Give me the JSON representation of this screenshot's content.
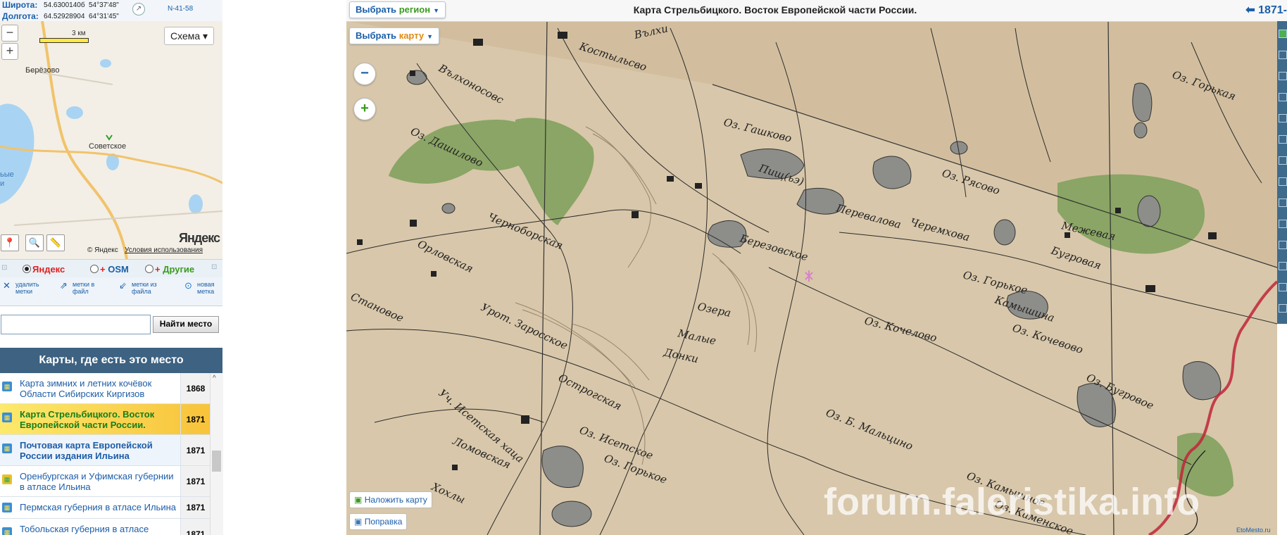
{
  "coords": {
    "lat_label": "Широта:",
    "lat_decimal": "54.6300140б",
    "lat_dms": "54°37'48\"",
    "lon_label": "Долгота:",
    "lon_decimal": "64.52928904",
    "lon_dms": "64°31'45\"",
    "sheet": "N-41-58"
  },
  "minimap": {
    "zoom_out": "−",
    "zoom_in": "+",
    "scale": "3 км",
    "type_select": "Схема",
    "towns": [
      "Берёзово",
      "Советское",
      "ьые",
      "и"
    ],
    "logo": "Яндекс",
    "copyright": "© Яндекс",
    "terms": "Условия использования"
  },
  "sources": {
    "yandex": "Яндекс",
    "osm": "OSM",
    "others": "Другие",
    "selected": "yandex"
  },
  "marks": {
    "delete": [
      "удалить",
      "метки"
    ],
    "to_file": [
      "метки в",
      "файл"
    ],
    "from_file": [
      "метки из",
      "файла"
    ],
    "new": [
      "новая",
      "метка"
    ]
  },
  "search": {
    "value": "",
    "button": "Найти место"
  },
  "maps_list": {
    "header": "Карты, где есть это место",
    "items": [
      {
        "title": "Карта зимних и летних кочёвок Области Сибирских Киргизов",
        "year": "1868",
        "state": "normal"
      },
      {
        "title": "Карта Стрельбицкого. Восток Европейской части России.",
        "year": "1871",
        "state": "selected"
      },
      {
        "title": "Почтовая карта Европейской России издания Ильина",
        "year": "1871",
        "state": "bold"
      },
      {
        "title": "Оренбургская и Уфимская губернии в атласе Ильина",
        "year": "1871",
        "state": "normal"
      },
      {
        "title": "Пермская губерния в атласе Ильина",
        "year": "1871",
        "state": "normal"
      },
      {
        "title": "Тобольская губерния в атласе",
        "year": "1871",
        "state": "normal"
      }
    ]
  },
  "map": {
    "title": "Карта Стрельбицкого. Восток Европейской части России.",
    "year_link": "1871-",
    "region_btn": {
      "text": "Выбрать",
      "accent": "регион"
    },
    "map_btn": {
      "text": "Выбрать",
      "accent": "карту"
    },
    "zoom_out": "−",
    "zoom_in": "+",
    "overlay_btn": "Наложить карту",
    "correction_btn": "Поправка",
    "watermark": "forum.faleristika.info",
    "credit": "EtoMesto.ru",
    "labels": [
      "Вълхоносовс",
      "Костыльсво",
      "Вълхи",
      "Оз. Дашилово",
      "Оз. Гашково",
      "Пищ(ьэ)",
      "Перевалова",
      "Черемхова",
      "Оз. Рясово",
      "Межевая",
      "Черноборская",
      "Березовское",
      "Озера",
      "Малые",
      "Донки",
      "Оз. Горькое",
      "Оз. Кочелово",
      "Оз. Кочевово",
      "Камышина",
      "Бугровая",
      "Оз. Бугровое",
      "Оз. Горькая",
      "Острогская",
      "Оз. Исетское",
      "Оз. Горькое",
      "Оз. Б. Мальцино",
      "Урот. Заросское",
      "Орловская",
      "Становое",
      "Уч. Исетская хаца",
      "Ломовская",
      "Хохлы",
      "Оз. Камышное",
      "Оз. Каменское"
    ]
  },
  "colors": {
    "panel_header": "#3d6282",
    "link": "#1b5ea9",
    "selected_row": "#f8c33a",
    "map_paper": "#d8c7aa",
    "forest": "#8aa565",
    "river": "#c0243a"
  }
}
